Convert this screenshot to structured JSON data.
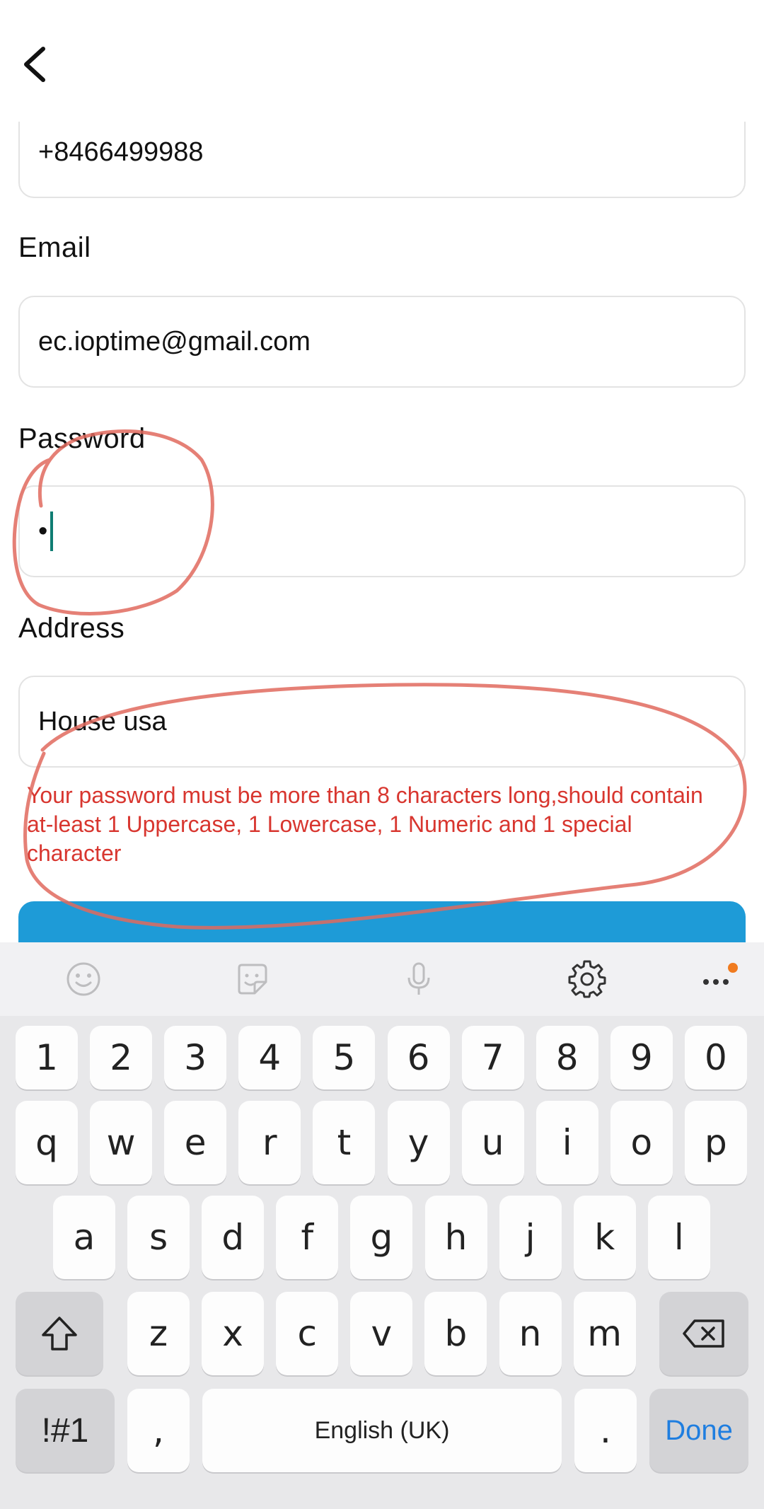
{
  "form": {
    "phone": {
      "value": "+8466499988"
    },
    "email": {
      "label": "Email",
      "value": "ec.ioptime@gmail.com"
    },
    "password": {
      "label": "Password",
      "value": "•"
    },
    "address": {
      "label": "Address",
      "value": "House usa"
    },
    "error_message": "Your password must be more than 8 characters long,should contain at-least 1 Uppercase, 1 Lowercase, 1 Numeric and 1 special character"
  },
  "colors": {
    "accent_button": "#1e9bd7",
    "error": "#d8362f",
    "annotation": "#e06a5e",
    "keyboard_accent": "#1f7ee0"
  },
  "toolbar": {
    "icons": [
      "emoji-icon",
      "sticker-icon",
      "mic-icon",
      "settings-icon",
      "more-icon"
    ]
  },
  "keyboard": {
    "number_row": [
      "1",
      "2",
      "3",
      "4",
      "5",
      "6",
      "7",
      "8",
      "9",
      "0"
    ],
    "row1": [
      "q",
      "w",
      "e",
      "r",
      "t",
      "y",
      "u",
      "i",
      "o",
      "p"
    ],
    "row2": [
      "a",
      "s",
      "d",
      "f",
      "g",
      "h",
      "j",
      "k",
      "l"
    ],
    "row3": [
      "z",
      "x",
      "c",
      "v",
      "b",
      "n",
      "m"
    ],
    "symbols_label": "!#1",
    "comma_label": ",",
    "space_label": "English (UK)",
    "period_label": ".",
    "done_label": "Done"
  }
}
